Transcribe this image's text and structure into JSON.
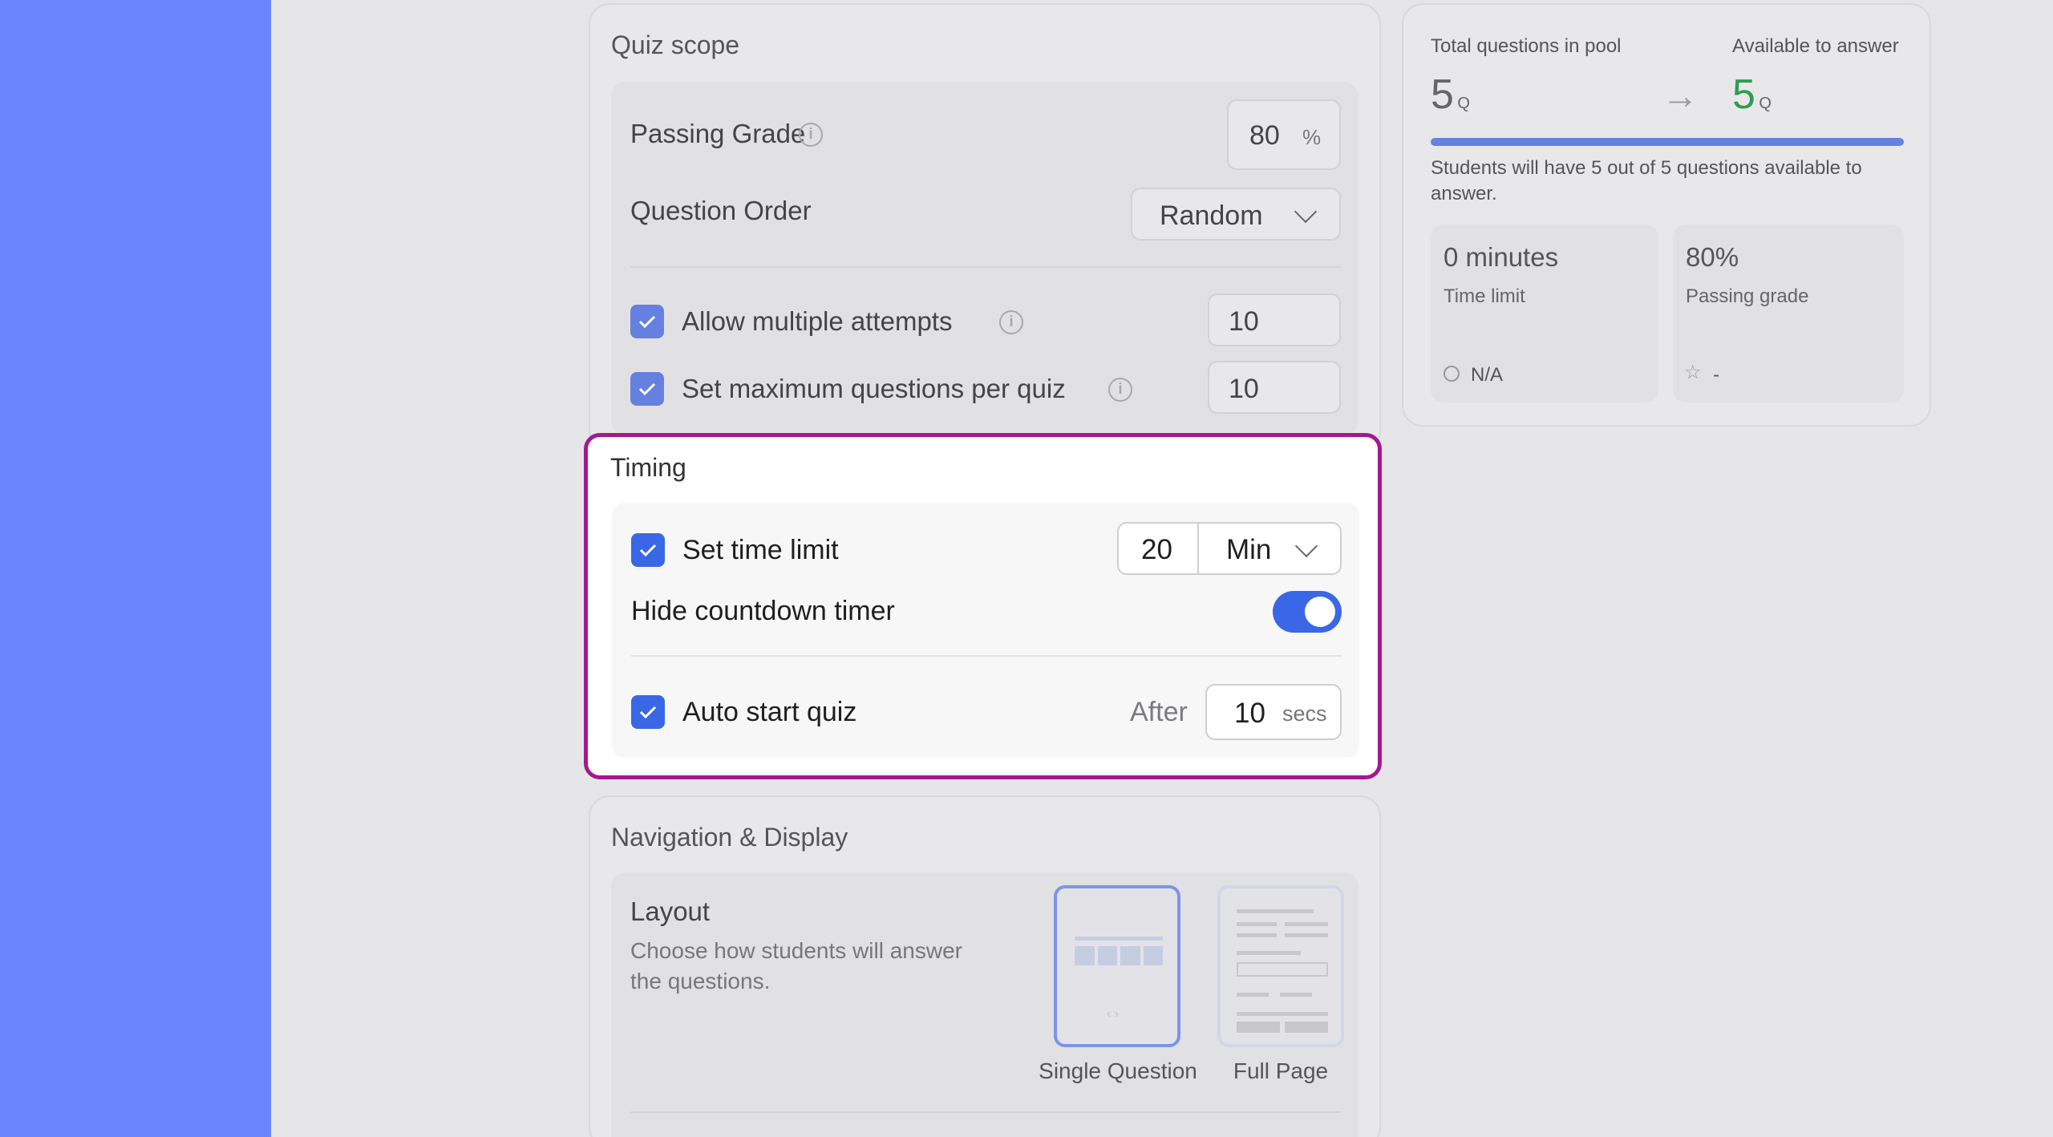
{
  "quiz_scope": {
    "title": "Quiz scope",
    "passing_grade_label": "Passing Grade",
    "passing_grade_value": "80",
    "passing_grade_unit": "%",
    "question_order_label": "Question Order",
    "question_order_value": "Random",
    "allow_attempts_label": "Allow multiple attempts",
    "allow_attempts_value": "10",
    "max_questions_label": "Set maximum questions per quiz",
    "max_questions_value": "10"
  },
  "timing": {
    "title": "Timing",
    "time_limit_label": "Set time limit",
    "time_limit_value": "20",
    "time_limit_unit": "Min",
    "hide_timer_label": "Hide countdown timer",
    "hide_timer_on": true,
    "auto_start_label": "Auto start quiz",
    "auto_start_after": "After",
    "auto_start_value": "10",
    "auto_start_unit": "secs"
  },
  "navigation": {
    "title": "Navigation & Display",
    "layout_title": "Layout",
    "layout_desc_1": "Choose how students will answer",
    "layout_desc_2": "the questions.",
    "option_single": "Single Question",
    "option_full": "Full Page"
  },
  "summary": {
    "total_label": "Total questions in pool",
    "available_label": "Available to answer",
    "total_value": "5",
    "total_unit": "Q",
    "available_value": "5",
    "available_unit": "Q",
    "available_color": "#2e9e4f",
    "note_1": "Students will have 5 out of 5 questions available to",
    "note_2": "answer.",
    "time_tile_value": "0 minutes",
    "time_tile_label": "Time limit",
    "time_tile_foot": "N/A",
    "grade_tile_value": "80%",
    "grade_tile_label": "Passing grade",
    "grade_tile_foot": "-"
  }
}
